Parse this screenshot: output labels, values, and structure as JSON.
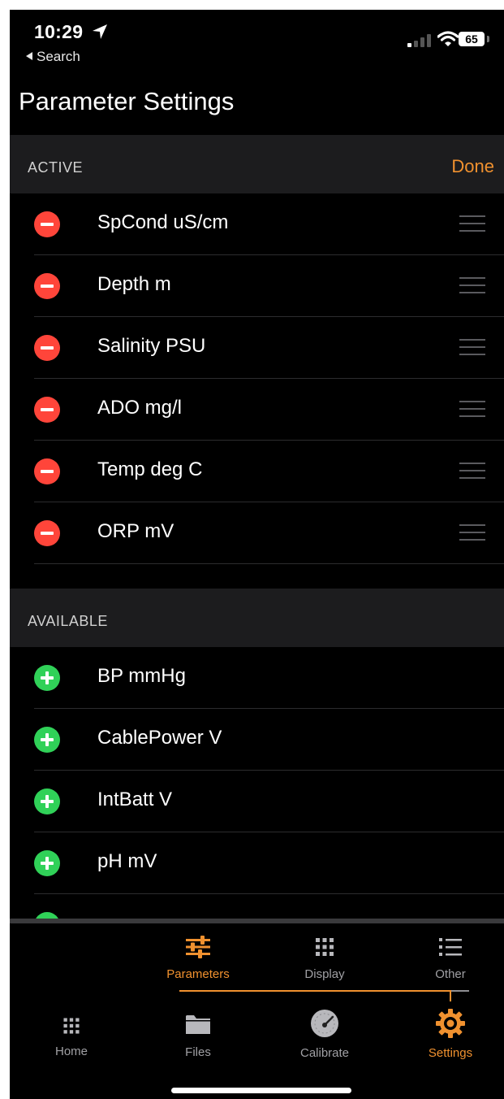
{
  "status_bar": {
    "time": "10:29",
    "back_label": "Search",
    "battery": "65"
  },
  "header": {
    "title": "Parameter Settings"
  },
  "active": {
    "label": "ACTIVE",
    "done_label": "Done",
    "items": [
      {
        "label": "SpCond uS/cm"
      },
      {
        "label": "Depth m"
      },
      {
        "label": "Salinity PSU"
      },
      {
        "label": "ADO mg/l"
      },
      {
        "label": "Temp deg C"
      },
      {
        "label": "ORP mV"
      }
    ]
  },
  "available": {
    "label": "AVAILABLE",
    "items": [
      {
        "label": "BP mmHg"
      },
      {
        "label": "CablePower V"
      },
      {
        "label": "IntBatt V"
      },
      {
        "label": "pH mV"
      }
    ]
  },
  "sub_tabs": [
    {
      "label": "Parameters",
      "icon": "sliders-icon",
      "selected": true
    },
    {
      "label": "Display",
      "icon": "grid-icon",
      "selected": false
    },
    {
      "label": "Other",
      "icon": "list-icon",
      "selected": false
    }
  ],
  "main_tabs": [
    {
      "label": "Home",
      "icon": "grid-icon",
      "selected": false
    },
    {
      "label": "Files",
      "icon": "folder-icon",
      "selected": false
    },
    {
      "label": "Calibrate",
      "icon": "gauge-icon",
      "selected": false
    },
    {
      "label": "Settings",
      "icon": "gear-icon",
      "selected": true
    }
  ],
  "colors": {
    "accent": "#f0912f",
    "remove": "#ff453a",
    "add": "#30d158",
    "background": "#000000",
    "section": "#1c1c1e"
  }
}
